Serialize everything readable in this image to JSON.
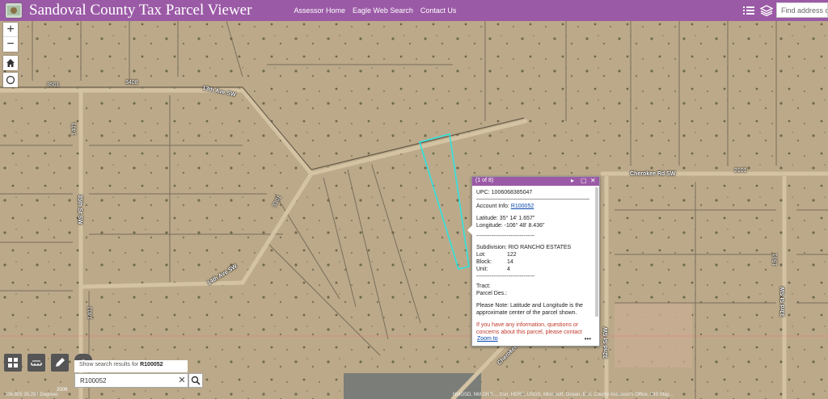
{
  "header": {
    "title": "Sandoval County Tax Parcel Viewer",
    "nav": [
      "Assessor Home",
      "Eagle Web Search",
      "Contact Us"
    ],
    "search_placeholder": "Find address or",
    "brand_color": "#9b5aa6"
  },
  "map": {
    "roads": {
      "13th Ave SW": "13th Ave SW",
      "14th Ave SW": "14th Ave SW",
      "35th St SW": "35th St SW",
      "33rd St SW": "33rd St SW",
      "32nd St SW": "32nd St SW",
      "Cherokee Rd SW": "Cherokee Rd SW",
      "Cherokee": "Cherokee"
    },
    "numbers": [
      "3501",
      "3408",
      "1401",
      "1402",
      "2101",
      "1501",
      "3301"
    ],
    "controls": {
      "zoom_in": "+",
      "zoom_out": "−"
    }
  },
  "search": {
    "hint_prefix": "Show search results for",
    "hint_term": "R100052",
    "value": "R100052",
    "clear": "✕"
  },
  "popup": {
    "counter": "(1 of 8)",
    "upc": "UPC: 1006068385047",
    "account_label": "Account Info:",
    "account_link": "R100052",
    "latitude": "Latitude: 35° 14' 1.657\"",
    "longitude": "Longitude: -106° 48' 8.436\"",
    "divider": "-------------------------------",
    "subdivision": "Subdivision: RIO RANCHO ESTATES",
    "lot_label": "Lot:",
    "lot": "122",
    "block_label": "Block:",
    "block": "14",
    "unit_label": "Unit:",
    "unit": "4",
    "tract": "Tract:",
    "parcel_des": "Parcel Des.:",
    "note": "Please Note: Latitude and Longitude is the approximate center of the parcel shown.",
    "contact": "If you have any information, questions or concerns about this parcel, please contact",
    "zoom": "Zoom to",
    "more": "•••"
  },
  "footer": {
    "attribution": "NMGSD, NM DNR..., Esri, HERE, USGS, Microsoft, Ocean, Esri, County Assessor's Office, GIS Map...",
    "coords": "-106.805 35.234 Degrees",
    "scale": "200ft"
  }
}
